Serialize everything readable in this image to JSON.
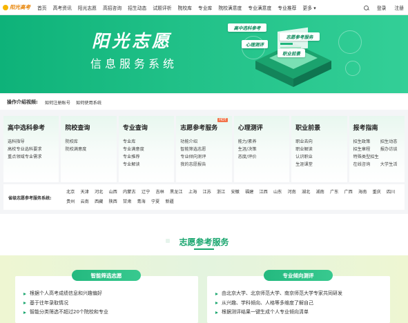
{
  "brand": {
    "logo_text": "阳光高考"
  },
  "nav": {
    "items": [
      "首页",
      "高考资讯",
      "阳光志愿",
      "高招咨询",
      "招生动态",
      "试题评析",
      "院校库",
      "专业库",
      "院校满意度",
      "专业满意度",
      "专业推荐",
      "更多 ▾"
    ],
    "login": "登录",
    "register": "注册"
  },
  "banner": {
    "title": "阳光志愿",
    "subtitle": "信息服务系统",
    "pills": [
      "高中选科参考",
      "志愿参考服务",
      "心理测评",
      "职业前景"
    ]
  },
  "video": {
    "label": "操作介绍视频:",
    "links": [
      "如何注册账号",
      "如何使用系统"
    ]
  },
  "categories": [
    {
      "title": "高中选科参考",
      "links": [
        "选科指导",
        "高校专业选科要求",
        "重点领域专业需求"
      ]
    },
    {
      "title": "院校查询",
      "links": [
        "院校库",
        "院校满意度"
      ]
    },
    {
      "title": "专业查询",
      "links": [
        "专业库",
        "专业满意度",
        "专业推荐",
        "专业解读"
      ]
    },
    {
      "title": "志愿参考服务",
      "badge": "HOT",
      "links": [
        "功能介绍",
        "智能筛选志愿",
        "专业倾向测评",
        "我的志愿报告"
      ]
    },
    {
      "title": "心理测评",
      "links": [
        "能力/素养",
        "生涯/决策",
        "态度/评价"
      ]
    },
    {
      "title": "职业前景",
      "links": [
        "职业去向",
        "职业解读",
        "认识职业",
        "生涯课堂"
      ]
    },
    {
      "title": "报考指南",
      "links": [
        "招生政策",
        "招生动态",
        "招生章程",
        "报办访谈",
        "特殊类型招生",
        "在线咨询",
        "大学生活"
      ]
    }
  ],
  "provinces": {
    "label": "省级志愿参考服务系统:",
    "items": [
      "北京",
      "天津",
      "河北",
      "山西",
      "内蒙古",
      "辽宁",
      "吉林",
      "黑龙江",
      "上海",
      "江苏",
      "浙江",
      "安徽",
      "福建",
      "江西",
      "山东",
      "河南",
      "湖北",
      "湖南",
      "广东",
      "广西",
      "海南",
      "重庆",
      "四川",
      "贵州",
      "云南",
      "西藏",
      "陕西",
      "甘肃",
      "青海",
      "宁夏",
      "新疆"
    ]
  },
  "section": {
    "title": "志愿参考服务"
  },
  "services": [
    {
      "title": "智能筛选志愿",
      "items": [
        "根据个人高考成绩信息和兴趣偏好",
        "基于往年录取情况",
        "智能分类筛选不超过20个院校和专业"
      ]
    },
    {
      "title": "专业倾向测评",
      "items": [
        "由北京大学、北京师范大学、南京师范大学专家共同研发",
        "从兴趣、学科倾向、人格等多维度了解自己",
        "根据测评结果一键生成个人专业倾向清单"
      ]
    }
  ]
}
